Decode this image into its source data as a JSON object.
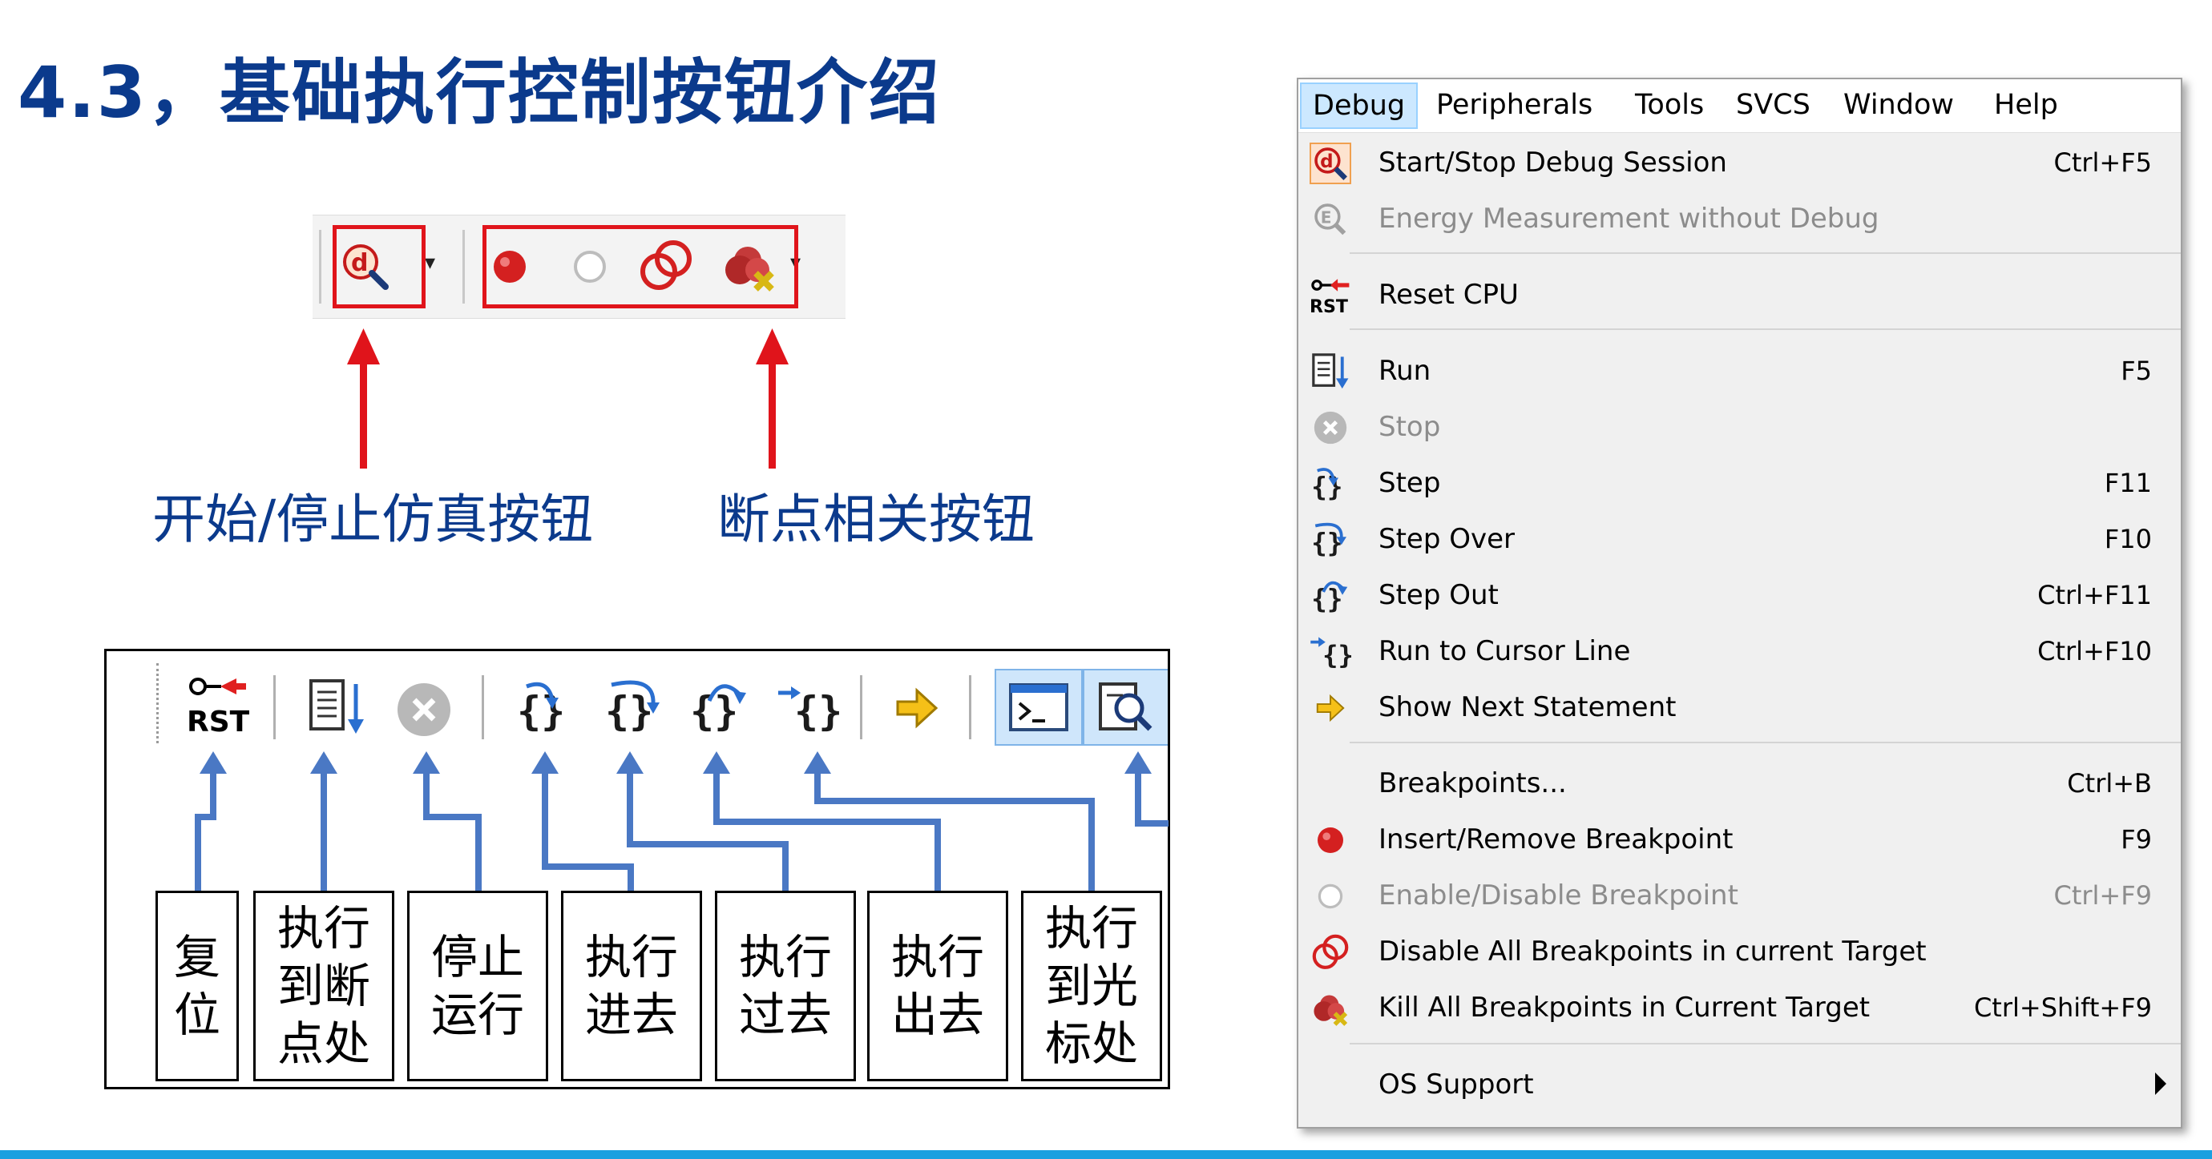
{
  "slide": {
    "title": "4.3，基础执行控制按钮介绍",
    "caption_debug": "开始/停止仿真按钮",
    "caption_breakpoints": "断点相关按钮",
    "labels": [
      "复\n位",
      "执行\n到断\n点处",
      "停止\n运行",
      "执行\n进去",
      "执行\n过去",
      "执行\n出去",
      "执行\n到光\n标处"
    ],
    "accent_color": "#0b3a8c",
    "arrow_red": "#e0141b",
    "arrow_blue": "#4a78c4"
  },
  "toolbar_top": {
    "icons": [
      "debug-session-icon",
      "insert-breakpoint-icon",
      "enable-breakpoint-icon",
      "disable-all-breakpoints-icon",
      "kill-all-breakpoints-icon"
    ]
  },
  "toolbar_bottom": {
    "icons": [
      "reset-cpu-icon",
      "run-icon",
      "stop-icon",
      "step-icon",
      "step-over-icon",
      "step-out-icon",
      "run-to-cursor-icon",
      "show-next-statement-icon",
      "command-window-icon",
      "disassembly-window-icon"
    ]
  },
  "menubar": [
    "Debug",
    "Peripherals",
    "Tools",
    "SVCS",
    "Window",
    "Help"
  ],
  "menu": [
    {
      "label": "Start/Stop Debug Session",
      "shortcut": "Ctrl+F5",
      "icon": "debug-session-icon",
      "enabled": true
    },
    {
      "label": "Energy Measurement without Debug",
      "shortcut": "",
      "icon": "energy-measurement-icon",
      "enabled": false
    },
    {
      "label": "Reset CPU",
      "shortcut": "",
      "icon": "reset-cpu-icon",
      "enabled": true
    },
    {
      "label": "Run",
      "shortcut": "F5",
      "icon": "run-icon",
      "enabled": true
    },
    {
      "label": "Stop",
      "shortcut": "",
      "icon": "stop-icon",
      "enabled": false
    },
    {
      "label": "Step",
      "shortcut": "F11",
      "icon": "step-icon",
      "enabled": true
    },
    {
      "label": "Step Over",
      "shortcut": "F10",
      "icon": "step-over-icon",
      "enabled": true
    },
    {
      "label": "Step Out",
      "shortcut": "Ctrl+F11",
      "icon": "step-out-icon",
      "enabled": true
    },
    {
      "label": "Run to Cursor Line",
      "shortcut": "Ctrl+F10",
      "icon": "run-to-cursor-icon",
      "enabled": true
    },
    {
      "label": "Show Next Statement",
      "shortcut": "",
      "icon": "show-next-statement-icon",
      "enabled": true
    },
    {
      "label": "Breakpoints...",
      "shortcut": "Ctrl+B",
      "icon": "",
      "enabled": true
    },
    {
      "label": "Insert/Remove Breakpoint",
      "shortcut": "F9",
      "icon": "insert-breakpoint-icon",
      "enabled": true
    },
    {
      "label": "Enable/Disable Breakpoint",
      "shortcut": "Ctrl+F9",
      "icon": "enable-breakpoint-icon",
      "enabled": false
    },
    {
      "label": "Disable All Breakpoints in current Target",
      "shortcut": "",
      "icon": "disable-all-breakpoints-icon",
      "enabled": true
    },
    {
      "label": "Kill All Breakpoints in Current Target",
      "shortcut": "Ctrl+Shift+F9",
      "icon": "kill-all-breakpoints-icon",
      "enabled": true
    },
    {
      "label": "OS Support",
      "shortcut": "",
      "icon": "",
      "enabled": true
    }
  ]
}
